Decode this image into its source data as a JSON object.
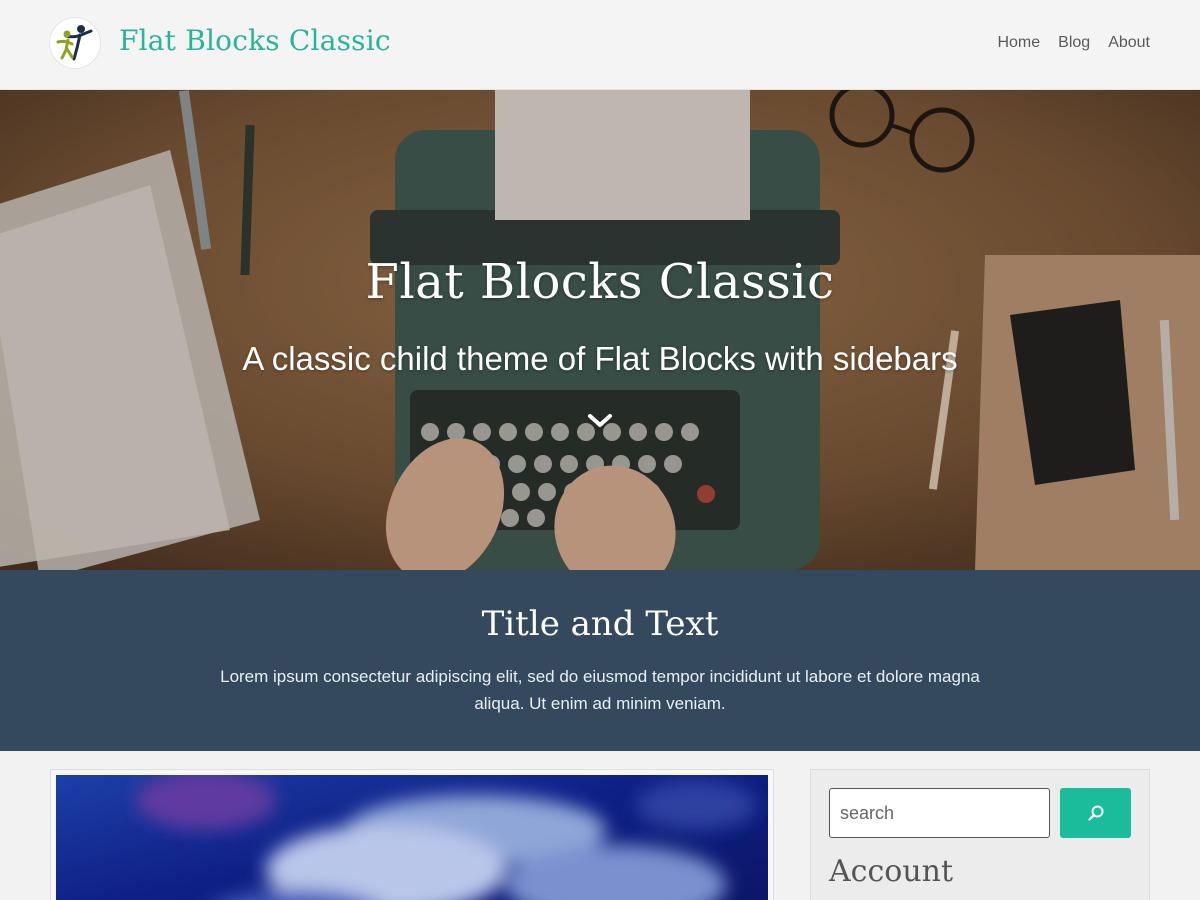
{
  "header": {
    "site_title": "Flat Blocks Classic",
    "logo_icon": "dancing-figures-logo",
    "nav": [
      {
        "label": "Home"
      },
      {
        "label": "Blog"
      },
      {
        "label": "About"
      }
    ]
  },
  "hero": {
    "title": "Flat Blocks Classic",
    "subtitle": "A classic child theme of Flat Blocks with sidebars",
    "scroll_icon": "chevron-down-icon"
  },
  "band": {
    "title": "Title and Text",
    "text": "Lorem ipsum consectetur adipiscing elit, sed do eiusmod tempor incididunt ut labore et dolore magna aliqua. Ut enim ad minim veniam."
  },
  "sidebar": {
    "search": {
      "placeholder": "search",
      "button_icon": "search-icon"
    },
    "widget_title": "Account"
  },
  "colors": {
    "accent": "#1abc9c",
    "site_title": "#2bb39a",
    "band_bg": "#34495e",
    "page_bg": "#f2f2f2"
  }
}
